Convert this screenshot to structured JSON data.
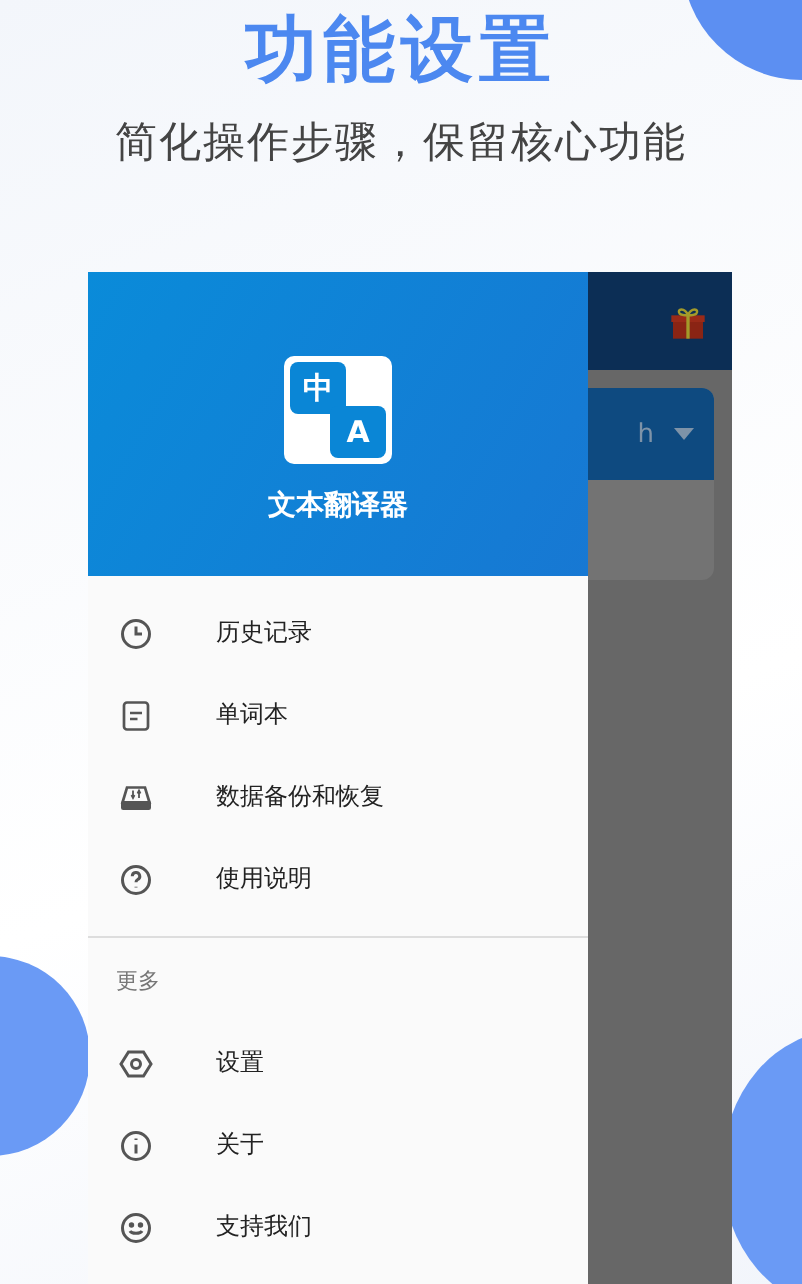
{
  "header": {
    "title": "功能设置",
    "subtitle": "简化操作步骤，保留核心功能"
  },
  "background_screen": {
    "language_label": "h"
  },
  "drawer": {
    "logo": {
      "top_char": "中",
      "bottom_char": "A"
    },
    "app_name": "文本翻译器",
    "items": [
      {
        "label": "历史记录"
      },
      {
        "label": "单词本"
      },
      {
        "label": "数据备份和恢复"
      },
      {
        "label": "使用说明"
      }
    ],
    "section_title": "更多",
    "more_items": [
      {
        "label": "设置"
      },
      {
        "label": "关于"
      },
      {
        "label": "支持我们"
      }
    ]
  }
}
